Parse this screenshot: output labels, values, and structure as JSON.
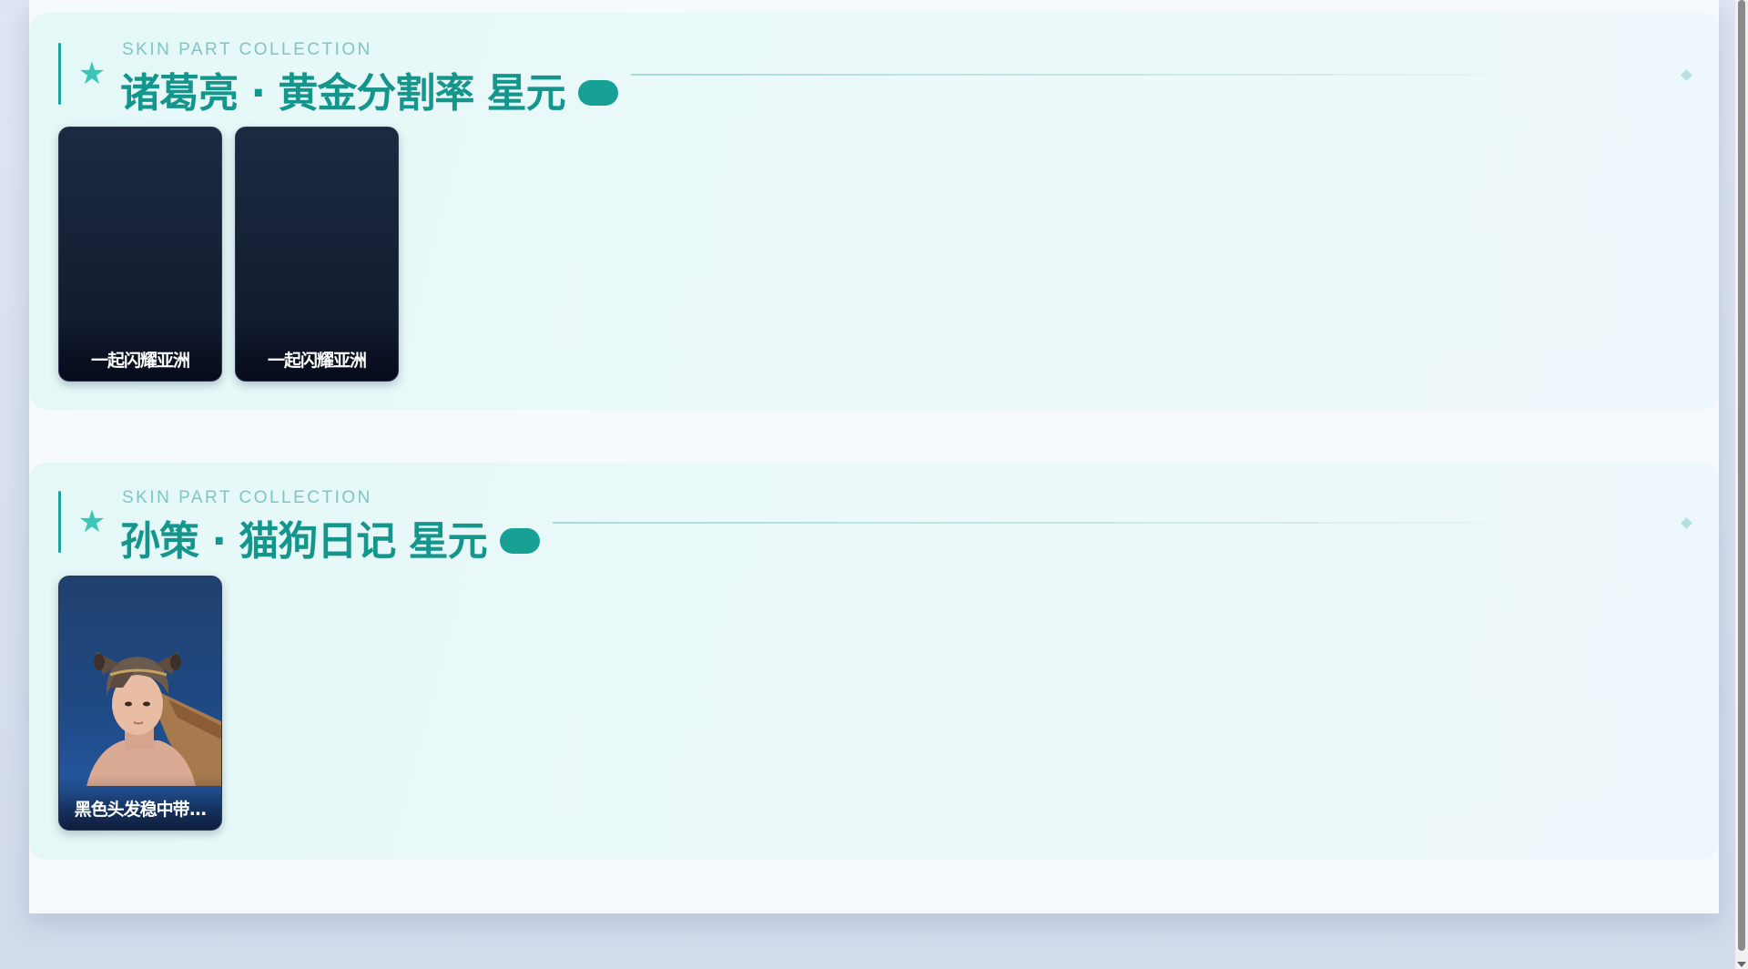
{
  "sections": [
    {
      "subtitle": "SKIN PART COLLECTION",
      "title": "诸葛亮 · 黄金分割率 星元",
      "icon": "star-icon",
      "cards": [
        {
          "label": "一起闪耀亚洲"
        },
        {
          "label": "一起闪耀亚洲"
        }
      ]
    },
    {
      "subtitle": "SKIN PART COLLECTION",
      "title": "孙策 · 猫狗日记 星元",
      "icon": "star-icon",
      "cards": [
        {
          "label": "黑色头发稳中带..."
        }
      ]
    }
  ],
  "colors": {
    "accent": "#14968c",
    "pill": "#16a194",
    "subtitle": "#7ec5c4"
  }
}
